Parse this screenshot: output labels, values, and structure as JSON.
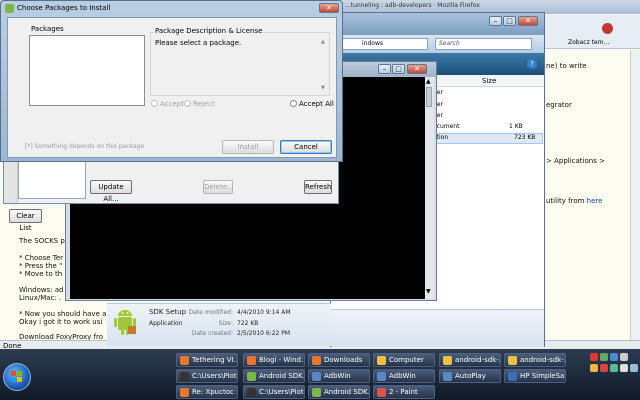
{
  "firefox": {
    "tab_title": "...tunneling : adb-developers · Mozilla Firefox",
    "lines": [
      {
        "text": "The SOCKS p"
      },
      {
        "text": "* Choose Ter"
      },
      {
        "text": "* Press the \""
      },
      {
        "text": "* Move to th"
      },
      {
        "text": "Windows: ad"
      },
      {
        "text": "Linux/Mac: ."
      },
      {
        "text": "* Now you should have a"
      },
      {
        "text": "Okay i got it to work usi"
      },
      {
        "text": "Download FoxyProxy fro"
      }
    ],
    "right_text": [
      {
        "text": "ne) to write"
      },
      {
        "text": "egrator"
      },
      {
        "text": "> Applications >"
      },
      {
        "text": "utility from",
        "link": "here"
      }
    ],
    "bookmark": "Zobacz tem...",
    "status": "Done"
  },
  "explorer": {
    "address": "indows",
    "search_placeholder": "Search",
    "column_size": "Size",
    "rows": [
      {
        "name": "der",
        "size": ""
      },
      {
        "name": "der",
        "size": ""
      },
      {
        "name": "der",
        "size": ""
      },
      {
        "name": "ocument",
        "size": "1 KB"
      },
      {
        "name": "ation",
        "size": "723 KB"
      }
    ],
    "details": {
      "name": "SDK Setup",
      "type": "Application",
      "modified_label": "Date modified:",
      "modified_value": "4/4/2010 9:14 AM",
      "size_label": "Size:",
      "size_value": "722 KB",
      "created_label": "Date created:",
      "created_value": "2/5/2010 6:22 PM"
    }
  },
  "sdk_manager": {
    "clear_list": "Clear List",
    "update_all": "Update All...",
    "delete": "Delete...",
    "refresh": "Refresh"
  },
  "dialog": {
    "title": "Choose Packages to Install",
    "packages_label": "Packages",
    "description_label": "Package Description & License",
    "description_text": "Please select a package.",
    "accept": "Accept",
    "reject": "Reject",
    "accept_all": "Accept All",
    "dependency_note": "[*] Something depends on this package",
    "install": "Install",
    "cancel": "Cancel"
  },
  "taskbar": {
    "row1": [
      {
        "label": "Tethering VI...",
        "color": "#e8762b"
      },
      {
        "label": "Blogi - Wind...",
        "color": "#e8762b"
      },
      {
        "label": "Downloads",
        "color": "#e8762b"
      },
      {
        "label": "Computer",
        "color": "#f0c040"
      },
      {
        "label": "android-sdk-...",
        "color": "#f0c040"
      },
      {
        "label": "android-sdk-...",
        "color": "#f0c040"
      }
    ],
    "row2": [
      {
        "label": "C:\\Users\\Piot...",
        "color": "#333333"
      },
      {
        "label": "Android SDK...",
        "color": "#7ab648"
      },
      {
        "label": "AdbWin",
        "color": "#5b87c5"
      },
      {
        "label": "AdbWin",
        "color": "#5b87c5"
      },
      {
        "label": "AutoPlay",
        "color": "#5b87c5"
      },
      {
        "label": "HP SimpleSa...",
        "color": "#3a6fbf"
      }
    ],
    "row3": [
      {
        "label": "Re: Xpuctoc ...",
        "color": "#e8762b"
      },
      {
        "label": "C:\\Users\\Piot...",
        "color": "#333333"
      },
      {
        "label": "Android SDK...",
        "color": "#7ab648"
      },
      {
        "label": "2 - Paint",
        "color": "#d9534f"
      }
    ]
  }
}
